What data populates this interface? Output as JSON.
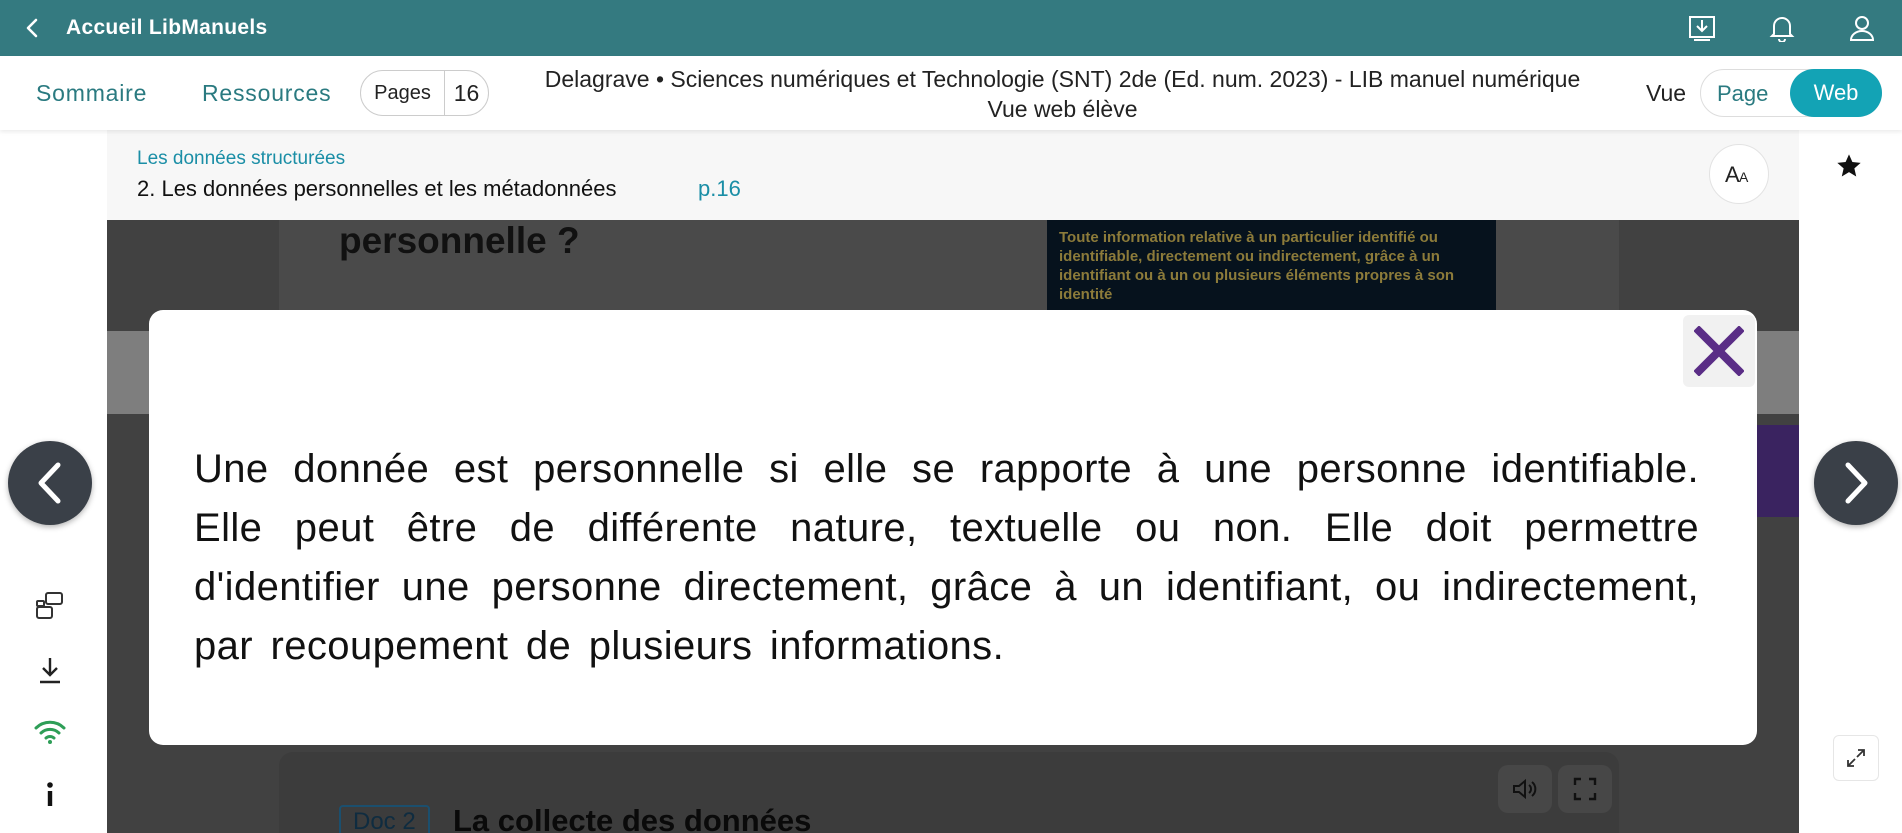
{
  "topbar": {
    "back_icon": "chevron-left-icon",
    "title": "Accueil LibManuels",
    "icons": [
      "download-box-icon",
      "bell-icon",
      "user-icon"
    ]
  },
  "nav": {
    "sommaire": "Sommaire",
    "ressources": "Ressources",
    "pages_label": "Pages",
    "page_number": "16",
    "book_title_line1": "Delagrave • Sciences numériques et Technologie (SNT) 2de (Ed. num. 2023) - LIB manuel numérique",
    "book_title_line2": "Vue web élève",
    "vue_label": "Vue",
    "view_page": "Page",
    "view_web": "Web",
    "view_selected": "Web"
  },
  "chapter": {
    "subtitle": "Les données structurées",
    "title": "2. Les données personnelles et les métadonnées",
    "page_ref": "p.16"
  },
  "content": {
    "heading_fragment": "personnelle ?",
    "definition_text": "Toute information relative à un particulier identifié ou identifiable, directement ou indirectement, grâce à un identifiant ou à un ou plusieurs éléments propres à son identité",
    "doc_label": "Doc 2",
    "doc_title": "La collecte des données"
  },
  "modal": {
    "text": "Une donnée est personnelle si elle se rapporte à une personne identifiable. Elle peut être de différente nature, textuelle ou non. Elle doit permettre d'identifier une personne directement, grâce à un identifiant, ou indirectement, par recoupement de plusieurs informations.",
    "close_icon": "close-icon"
  },
  "colors": {
    "topbar_bg": "#347a80",
    "accent_teal": "#13a3b5",
    "link_teal": "#2a7a80",
    "close_purple": "#5a2d86",
    "wifi_green": "#2e9e57"
  }
}
